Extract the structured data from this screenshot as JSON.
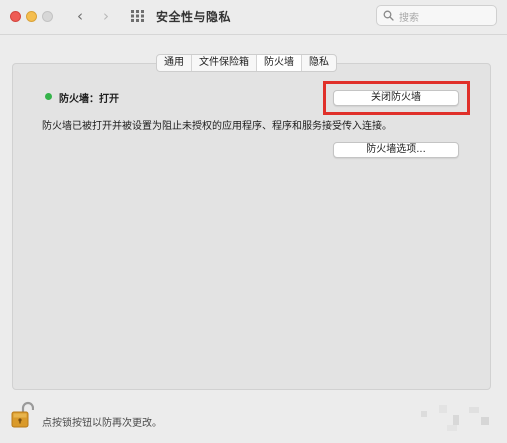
{
  "window": {
    "title": "安全性与隐私"
  },
  "search": {
    "placeholder": "搜索"
  },
  "tabs": [
    {
      "label": "通用",
      "active": false
    },
    {
      "label": "文件保险箱",
      "active": false
    },
    {
      "label": "防火墙",
      "active": true
    },
    {
      "label": "隐私",
      "active": false
    }
  ],
  "firewall": {
    "status": "防火墙：打开",
    "status_color": "#35b34a",
    "description": "防火墙已被打开并被设置为阻止未授权的应用程序、程序和服务接受传入连接。",
    "turn_off_label": "关闭防火墙",
    "options_label": "防火墙选项..."
  },
  "footer": {
    "lock_text": "点按锁按钮以防再次更改。"
  },
  "icons": {
    "back": "chevron-left-icon",
    "forward": "chevron-right-icon",
    "grid": "grid-icon",
    "search": "magnifier-icon",
    "lock": "lock-icon"
  },
  "colors": {
    "highlight": "#e0302a",
    "close": "#ee5c55",
    "minimize": "#f5be4f",
    "zoom_disabled": "#d7d7d7"
  }
}
